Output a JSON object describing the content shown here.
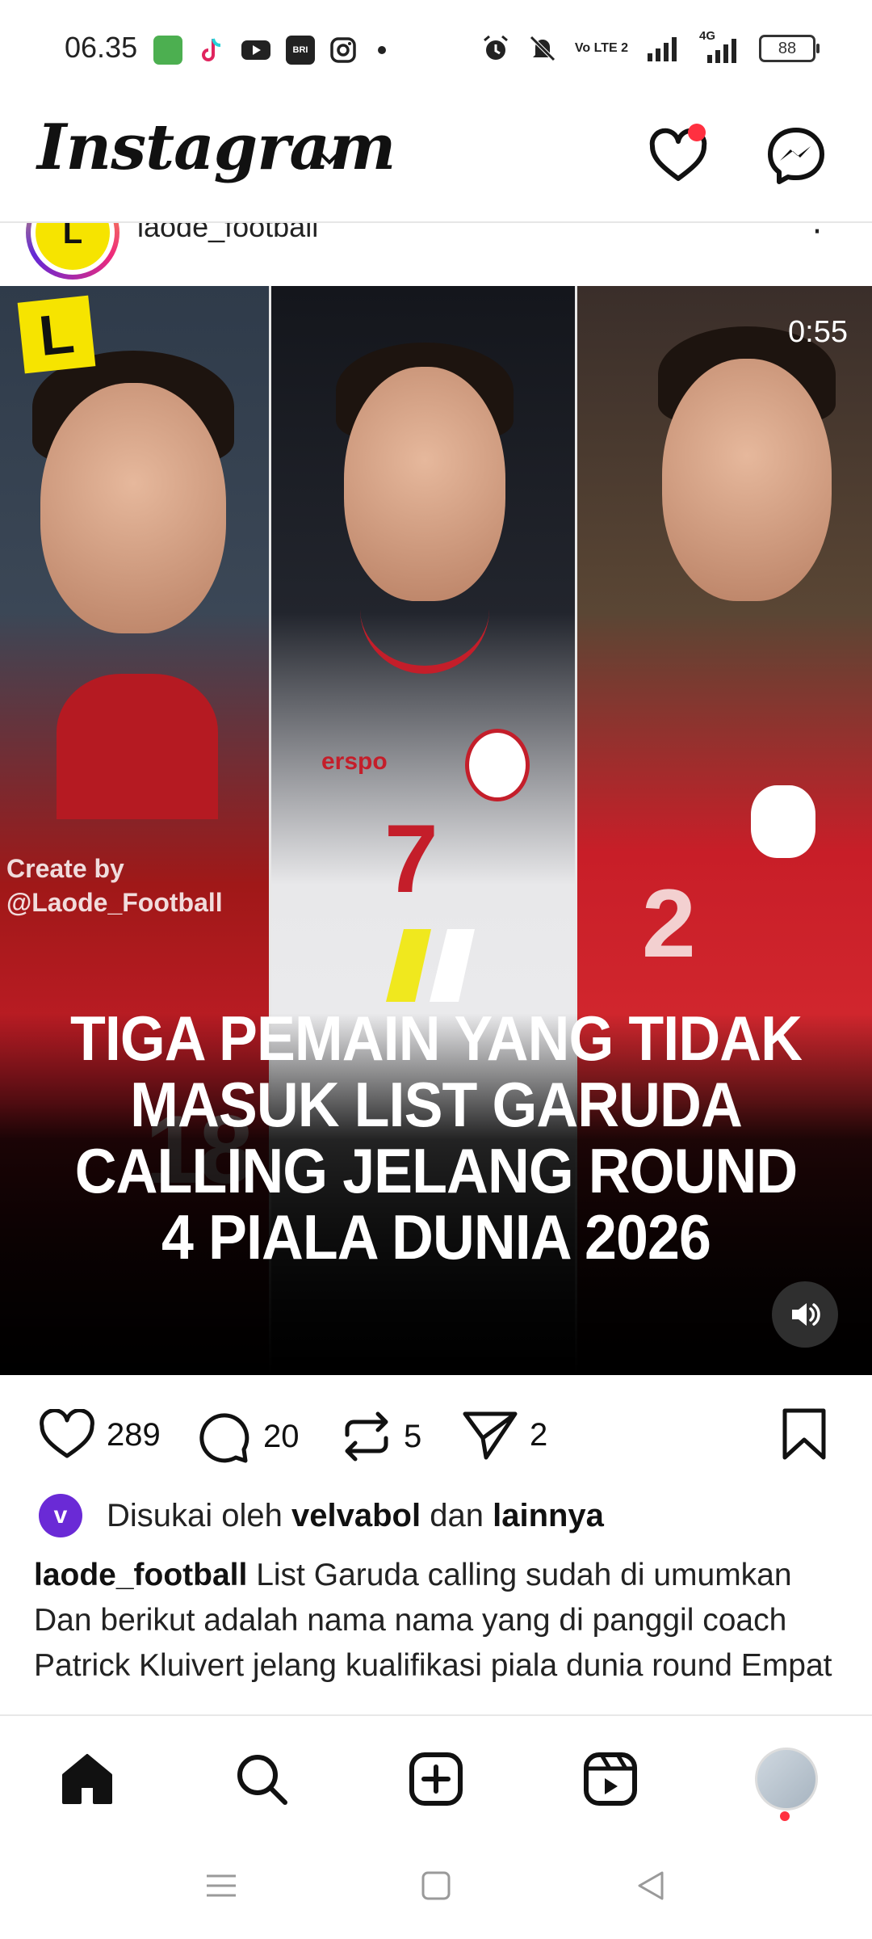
{
  "status_bar": {
    "time": "06.35",
    "battery": "88",
    "network": "4G",
    "volte": "Vo LTE 2"
  },
  "header": {
    "app_title": "Instagram"
  },
  "post": {
    "username": "laode_football",
    "video_duration": "0:55",
    "watermark_line1": "Create by",
    "watermark_line2": "@Laode_Football",
    "brand_letter": "L",
    "jersey_numbers": [
      "18",
      "7",
      "2"
    ],
    "jersey_brand": "erspo",
    "headline": "TIGA PEMAIN YANG TIDAK MASUK LIST GARUDA CALLING JELANG ROUND 4 PIALA DUNIA 2026",
    "likes": "289",
    "comments": "20",
    "reposts": "5",
    "shares": "2",
    "liked_by_prefix": "Disukai oleh",
    "liked_by_user": "velvabol",
    "liked_by_and": "dan",
    "liked_by_others": "lainnya",
    "liked_badge": "v",
    "caption_user": "laode_football",
    "caption_text": "List Garuda calling sudah di umumkan Dan berikut adalah nama nama yang di panggil coach Patrick Kluivert jelang kualifikasi piala dunia round Empat"
  },
  "bottom_nav": {
    "items": [
      "home",
      "search",
      "create",
      "reels",
      "profile"
    ]
  },
  "colors": {
    "notification": "#ff3040",
    "badge": "#6a2ad6",
    "brand_yellow": "#f6e400"
  }
}
